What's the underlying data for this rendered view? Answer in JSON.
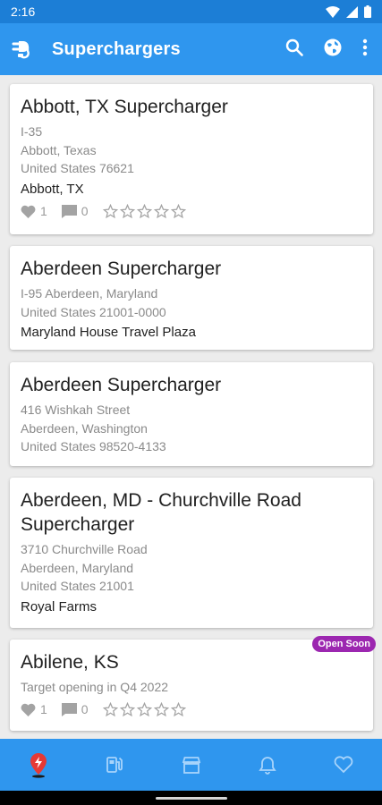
{
  "status_bar": {
    "time": "2:16"
  },
  "app_bar": {
    "title": "Superchargers",
    "logo_icon": "charger-plug-icon",
    "actions": [
      "search-icon",
      "globe-icon",
      "more-vert-icon"
    ]
  },
  "cards": [
    {
      "title": "Abbott, TX Supercharger",
      "lines": [
        "I-35",
        "Abbott, Texas",
        "United States 76621"
      ],
      "place": "Abbott, TX",
      "likes": "1",
      "comments": "0",
      "rating": 0
    },
    {
      "title": "Aberdeen Supercharger",
      "lines": [
        "I-95 Aberdeen, Maryland",
        "United States 21001-0000"
      ],
      "place": "Maryland House Travel Plaza"
    },
    {
      "title": "Aberdeen Supercharger",
      "lines": [
        "416 Wishkah Street",
        "Aberdeen, Washington",
        "United States 98520-4133"
      ]
    },
    {
      "title": "Aberdeen, MD - Churchville Road Supercharger",
      "lines": [
        "3710 Churchville Road",
        "Aberdeen, Maryland",
        "United States 21001"
      ],
      "place": "Royal Farms"
    },
    {
      "title": "Abilene, KS",
      "lines": [
        "Target opening in Q4 2022"
      ],
      "likes": "1",
      "comments": "0",
      "rating": 0,
      "badge": "Open Soon"
    }
  ],
  "bottom_nav": [
    "map-pin-icon",
    "fuel-station-icon",
    "store-icon",
    "bell-icon",
    "heart-icon"
  ],
  "colors": {
    "primary": "#2f96ee",
    "status_bar": "#1c7ed6",
    "badge": "#9c27b0",
    "active_nav": "#e53935"
  }
}
